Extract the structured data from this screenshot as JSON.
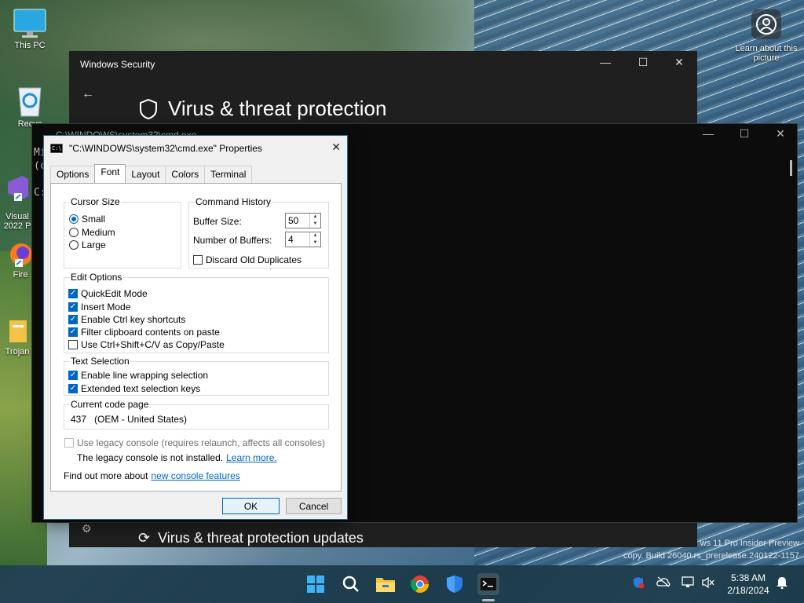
{
  "desktop": {
    "icons": [
      {
        "label": "This PC"
      },
      {
        "label": "Recyc"
      },
      {
        "label": "Visual\n2022 P"
      },
      {
        "label": "Fire"
      },
      {
        "label": "Trojan"
      }
    ],
    "learn_picture": "Learn about this picture"
  },
  "security_window": {
    "title": "Windows Security",
    "heading": "Virus & threat protection",
    "bottom_heading": "Virus & threat protection updates"
  },
  "cmd_window": {
    "title": "C:\\WINDOWS\\system32\\cmd.exe",
    "side_text": [
      "Mi",
      "(c",
      "",
      "C:"
    ]
  },
  "dialog": {
    "title": "\"C:\\WINDOWS\\system32\\cmd.exe\" Properties",
    "tabs": [
      "Options",
      "Font",
      "Layout",
      "Colors",
      "Terminal"
    ],
    "cursor_size": {
      "label": "Cursor Size",
      "options": [
        "Small",
        "Medium",
        "Large"
      ],
      "selected": "Small"
    },
    "command_history": {
      "label": "Command History",
      "buffer_size_label": "Buffer Size:",
      "buffer_size_value": "50",
      "num_buffers_label": "Number of Buffers:",
      "num_buffers_value": "4",
      "discard_label": "Discard Old Duplicates"
    },
    "edit_options": {
      "label": "Edit Options",
      "items": [
        {
          "label": "QuickEdit Mode",
          "checked": true
        },
        {
          "label": "Insert Mode",
          "checked": true
        },
        {
          "label": "Enable Ctrl key shortcuts",
          "checked": true
        },
        {
          "label": "Filter clipboard contents on paste",
          "checked": true
        },
        {
          "label": "Use Ctrl+Shift+C/V as Copy/Paste",
          "checked": false
        }
      ]
    },
    "text_selection": {
      "label": "Text Selection",
      "items": [
        {
          "label": "Enable line wrapping selection",
          "checked": true
        },
        {
          "label": "Extended text selection keys",
          "checked": true
        }
      ]
    },
    "code_page": {
      "label": "Current code page",
      "value": "437   (OEM - United States)"
    },
    "legacy": {
      "checkbox_label": "Use legacy console (requires relaunch, affects all consoles)",
      "note": "The legacy console is not installed.",
      "learn_more": "Learn more."
    },
    "find_out": {
      "text": "Find out more about",
      "link": "new console features"
    },
    "ok_label": "OK",
    "cancel_label": "Cancel"
  },
  "taskbar": {
    "time": "5:38 AM",
    "date": "2/18/2024"
  },
  "watermark": {
    "line1": "ws 11 Pro Insider Preview",
    "line2": "copy. Build 26040.rs_prerelease.240122-1157"
  }
}
